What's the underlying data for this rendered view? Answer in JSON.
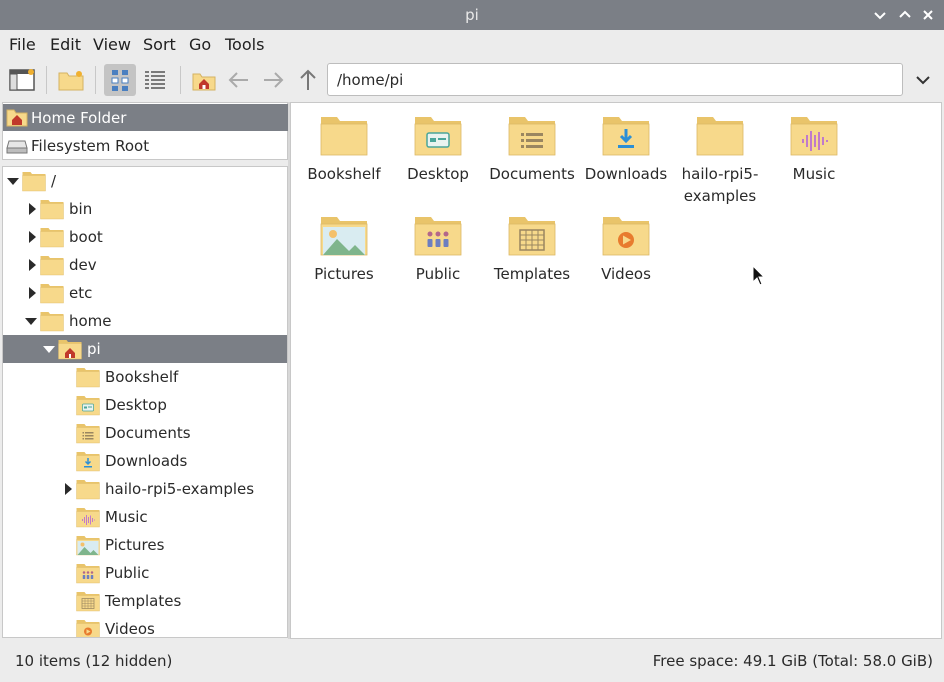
{
  "window": {
    "title": "pi",
    "minimize_icon": "chevron-down-icon",
    "maximize_icon": "chevron-up-icon",
    "close_icon": "close-icon"
  },
  "menu": [
    "File",
    "Edit",
    "View",
    "Sort",
    "Go",
    "Tools"
  ],
  "toolbar": {
    "path": "/home/pi",
    "buttons": [
      "new-window-icon",
      "new-folder-icon",
      "icon-view-icon",
      "list-view-icon",
      "home-icon",
      "back-arrow-icon",
      "forward-arrow-icon",
      "up-arrow-icon"
    ]
  },
  "places": [
    {
      "label": "Home Folder",
      "icon": "home-folder-icon",
      "selected": true
    },
    {
      "label": "Filesystem Root",
      "icon": "drive-icon",
      "selected": false
    }
  ],
  "tree": [
    {
      "label": "/",
      "level": 0,
      "expander": "open",
      "type": "folder"
    },
    {
      "label": "bin",
      "level": 1,
      "expander": "closed",
      "type": "folder"
    },
    {
      "label": "boot",
      "level": 1,
      "expander": "closed",
      "type": "folder"
    },
    {
      "label": "dev",
      "level": 1,
      "expander": "closed",
      "type": "folder"
    },
    {
      "label": "etc",
      "level": 1,
      "expander": "closed",
      "type": "folder"
    },
    {
      "label": "home",
      "level": 1,
      "expander": "open",
      "type": "folder"
    },
    {
      "label": "pi",
      "level": 2,
      "expander": "open",
      "type": "home",
      "selected": true
    },
    {
      "label": "Bookshelf",
      "level": 3,
      "expander": "none",
      "type": "folder"
    },
    {
      "label": "Desktop",
      "level": 3,
      "expander": "none",
      "type": "desktop"
    },
    {
      "label": "Documents",
      "level": 3,
      "expander": "none",
      "type": "documents"
    },
    {
      "label": "Downloads",
      "level": 3,
      "expander": "none",
      "type": "downloads"
    },
    {
      "label": "hailo-rpi5-examples",
      "level": 3,
      "expander": "closed",
      "type": "folder"
    },
    {
      "label": "Music",
      "level": 3,
      "expander": "none",
      "type": "music"
    },
    {
      "label": "Pictures",
      "level": 3,
      "expander": "none",
      "type": "pictures"
    },
    {
      "label": "Public",
      "level": 3,
      "expander": "none",
      "type": "public"
    },
    {
      "label": "Templates",
      "level": 3,
      "expander": "none",
      "type": "templates"
    },
    {
      "label": "Videos",
      "level": 3,
      "expander": "none",
      "type": "videos"
    }
  ],
  "files": [
    {
      "label": "Bookshelf",
      "type": "folder"
    },
    {
      "label": "Desktop",
      "type": "desktop"
    },
    {
      "label": "Documents",
      "type": "documents"
    },
    {
      "label": "Downloads",
      "type": "downloads"
    },
    {
      "label": "hailo-rpi5-\nexamples",
      "type": "folder"
    },
    {
      "label": "Music",
      "type": "music"
    },
    {
      "label": "Pictures",
      "type": "pictures"
    },
    {
      "label": "Public",
      "type": "public"
    },
    {
      "label": "Templates",
      "type": "templates"
    },
    {
      "label": "Videos",
      "type": "videos"
    }
  ],
  "status": {
    "items": "10 items (12 hidden)",
    "free_space": "Free space: 49.1 GiB (Total: 58.0 GiB)"
  },
  "colors": {
    "titlebar": "#7b7f86",
    "selection": "#7b7f86",
    "folder": "#f7d98b",
    "folder_dark": "#e9c46a"
  }
}
